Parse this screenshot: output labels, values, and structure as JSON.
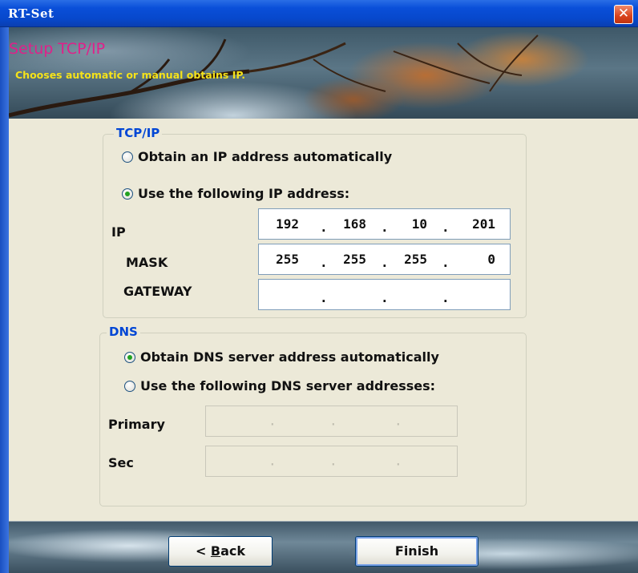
{
  "window": {
    "title": "RT-Set",
    "close_glyph": "✕"
  },
  "banner": {
    "heading": "Setup TCP/IP",
    "subheading": "Chooses automatic or manual obtains IP."
  },
  "tcpip": {
    "legend": "TCP/IP",
    "option_auto": "Obtain an IP address automatically",
    "option_manual": "Use the following IP address:",
    "selected": "manual",
    "ip": {
      "label": "IP",
      "octets": [
        "192",
        "168",
        "10",
        "201"
      ]
    },
    "mask": {
      "label": "MASK",
      "octets": [
        "255",
        "255",
        "255",
        "0"
      ]
    },
    "gateway": {
      "label": "GATEWAY",
      "octets": [
        "",
        "",
        "",
        ""
      ]
    }
  },
  "dns": {
    "legend": "DNS",
    "option_auto": "Obtain DNS server address automatically",
    "option_manual": "Use the following DNS server addresses:",
    "selected": "auto",
    "primary": {
      "label": "Primary",
      "octets": [
        "",
        "",
        "",
        ""
      ]
    },
    "secondary": {
      "label": "Sec",
      "octets": [
        "",
        "",
        "",
        ""
      ]
    }
  },
  "buttons": {
    "back_prefix": "< ",
    "back_mnemonic": "B",
    "back_rest": "ack",
    "finish": "Finish"
  },
  "colors": {
    "titlebar": "#0a4fd9",
    "heading": "#e0208a",
    "subheading": "#f5e21a",
    "legend": "#0046d5",
    "dialog_bg": "#ece9d8"
  }
}
